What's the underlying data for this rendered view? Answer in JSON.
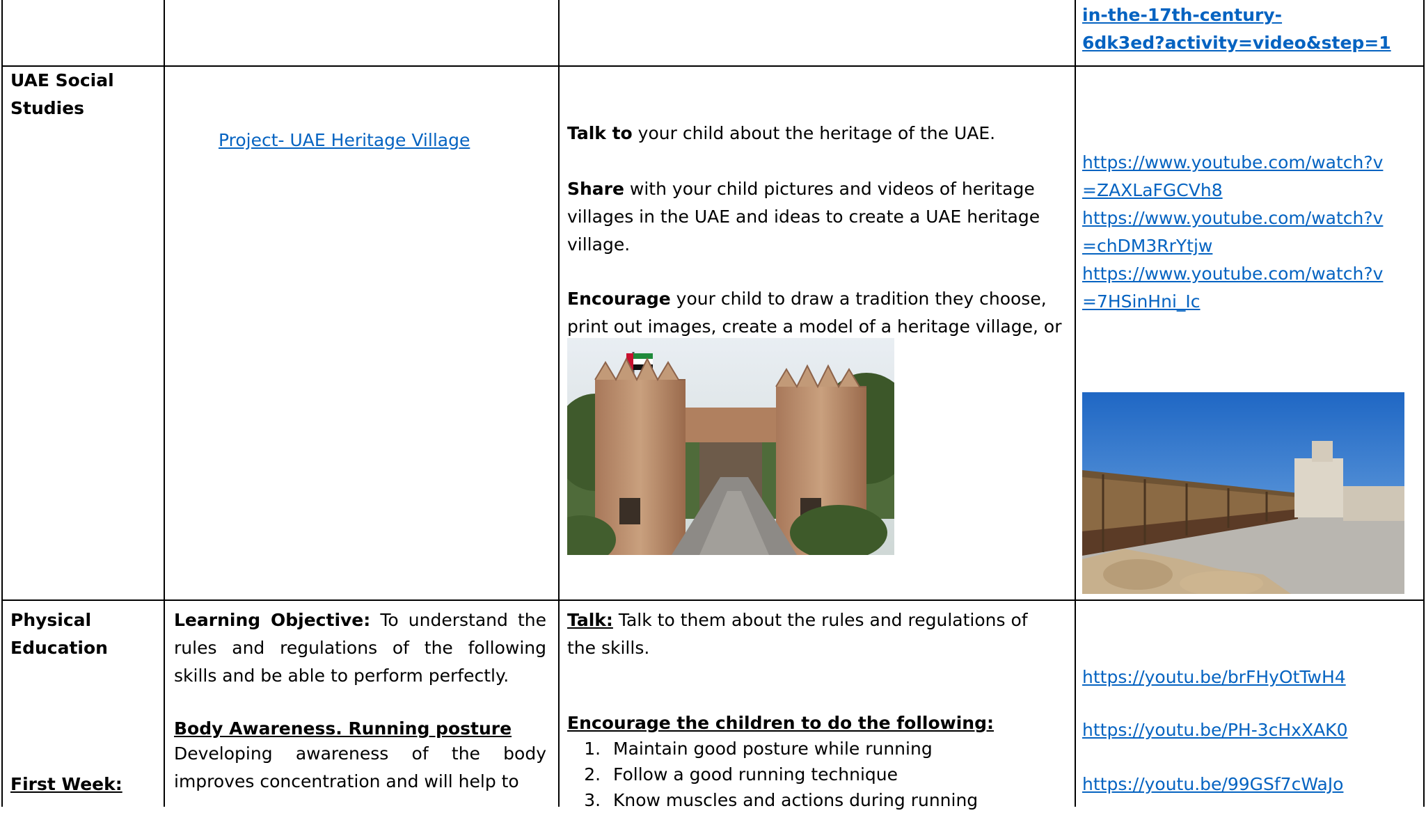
{
  "top_row": {
    "link_line1": "in-the-17th-century-",
    "link_line2": "6dk3ed?activity=video&step=1"
  },
  "social_studies": {
    "subject_line1": "UAE Social",
    "subject_line2": "Studies",
    "project_link": "Project- UAE Heritage Village",
    "para1_bold": "Talk to",
    "para1_rest": " your child about the heritage of the UAE.",
    "para2_bold": "Share",
    "para2_rest": " with your child pictures and videos of heritage villages in the UAE and ideas to create a UAE heritage village.",
    "para3_bold": "Encourage",
    "para3_rest": " your child to draw a tradition they choose, print out images, create a model of a heritage village, or act out a tradition.",
    "links": [
      {
        "line1": "https://www.youtube.com/watch?v",
        "line2": "=ZAXLaFGCVh8"
      },
      {
        "line1": "https://www.youtube.com/watch?v",
        "line2": "=chDM3RrYtjw"
      },
      {
        "line1": "https://www.youtube.com/watch?v",
        "line2": "=7HSinHni_Ic"
      }
    ]
  },
  "physical_education": {
    "subject_line1": "Physical",
    "subject_line2": "Education",
    "week_label": "First Week:",
    "objective_bold": "Learning Objective:",
    "objective_rest": " To understand the rules and regulations of the following skills and be able to perform perfectly.",
    "section_heading": "Body Awareness. Running posture",
    "section_text": "Developing awareness of the body improves concentration and will help to",
    "talk_bold": "Talk:",
    "talk_rest": " Talk to them about the rules and regulations of the skills.",
    "encourage_heading": "Encourage the children to do the following:",
    "steps": [
      "Maintain good posture while running",
      "Follow a good running technique",
      "Know muscles and actions during running"
    ],
    "links": [
      "https://youtu.be/brFHyOtTwH4",
      "https://youtu.be/PH-3cHxXAK0",
      "https://youtu.be/99GSf7cWaJo"
    ]
  }
}
